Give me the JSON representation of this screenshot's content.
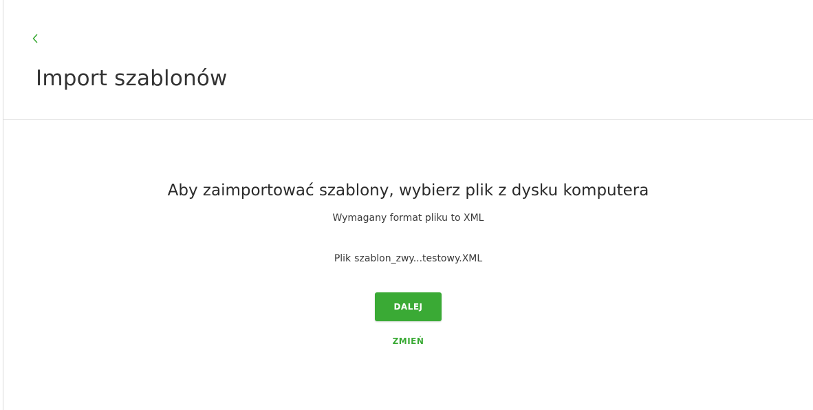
{
  "header": {
    "back_icon": "chevron-left-icon",
    "title": "Import szablonów"
  },
  "import": {
    "heading": "Aby zaimportować szablony, wybierz plik z dysku komputera",
    "format_info": "Wymagany format pliku to XML",
    "file_label": "Plik",
    "file_name": "szablon_zwy...testowy.XML",
    "next_button": "DALEJ",
    "change_link": "ZMIEŃ"
  },
  "colors": {
    "accent": "#3aaa35",
    "divider": "#e6e6e6",
    "text": "#2b2b2b"
  }
}
